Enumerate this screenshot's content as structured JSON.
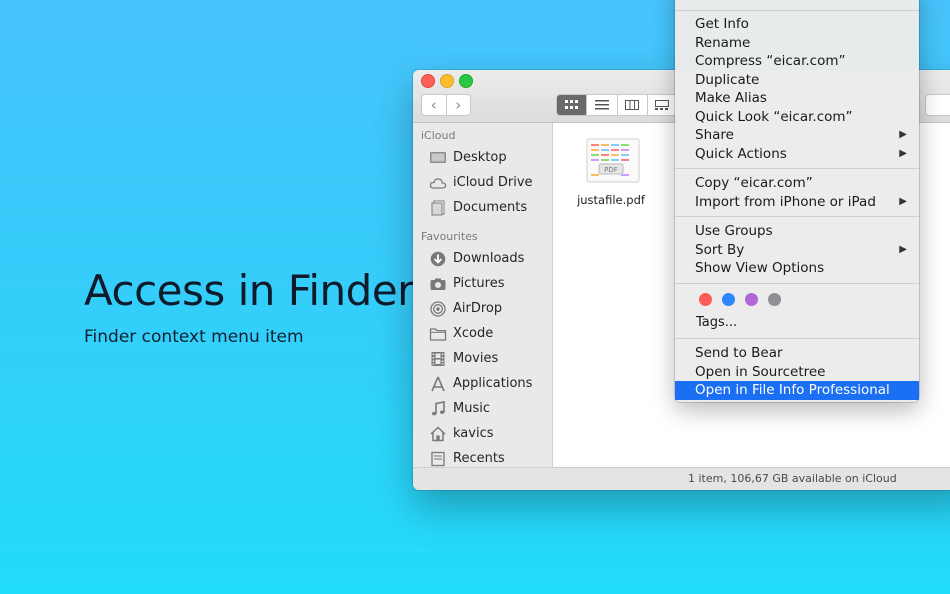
{
  "hero": {
    "title": "Access in Finder",
    "subtitle": "Finder context menu item"
  },
  "finder": {
    "nav": {
      "back": "‹",
      "forward": "›"
    },
    "sidebar": {
      "icloud_header": "iCloud",
      "icloud_items": [
        {
          "label": "Desktop",
          "icon": "desktop-icon"
        },
        {
          "label": "iCloud Drive",
          "icon": "cloud-icon"
        },
        {
          "label": "Documents",
          "icon": "documents-icon"
        }
      ],
      "favourites_header": "Favourites",
      "favourite_items": [
        {
          "label": "Downloads",
          "icon": "downloads-icon"
        },
        {
          "label": "Pictures",
          "icon": "camera-icon"
        },
        {
          "label": "AirDrop",
          "icon": "airdrop-icon"
        },
        {
          "label": "Xcode",
          "icon": "folder-icon"
        },
        {
          "label": "Movies",
          "icon": "film-icon"
        },
        {
          "label": "Applications",
          "icon": "applications-icon"
        },
        {
          "label": "Music",
          "icon": "music-icon"
        },
        {
          "label": "kavics",
          "icon": "home-icon"
        },
        {
          "label": "Recents",
          "icon": "recents-icon"
        }
      ]
    },
    "file": {
      "name": "justafile.pdf",
      "badge": "PDF"
    },
    "status": "1 item, 106,67 GB available on iCloud"
  },
  "menu": {
    "group1": [
      "Get Info",
      "Rename",
      "Compress “eicar.com”",
      "Duplicate",
      "Make Alias",
      "Quick Look “eicar.com”",
      "Share",
      "Quick Actions"
    ],
    "group2": [
      "Copy “eicar.com”",
      "Import from iPhone or iPad"
    ],
    "group3": [
      "Use Groups",
      "Sort By",
      "Show View Options"
    ],
    "tags_label": "Tags...",
    "tag_colors": [
      "#fd5b57",
      "#2f86fb",
      "#b267d6",
      "#8e8e93"
    ],
    "group5": [
      "Send to Bear",
      "Open in Sourcetree",
      "Open in File Info Professional"
    ],
    "submenu_arrow": "▶",
    "highlight_color": "#1a6ff2"
  }
}
